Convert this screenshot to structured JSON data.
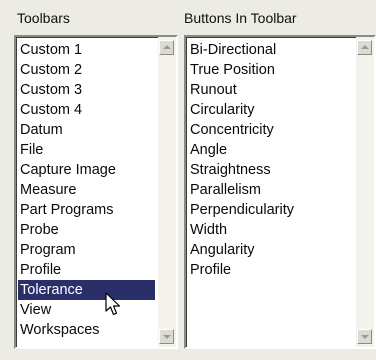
{
  "toolbars": {
    "label": "Toolbars",
    "items": [
      "Custom 1",
      "Custom 2",
      "Custom 3",
      "Custom 4",
      "Datum",
      "File",
      "Capture Image",
      "Measure",
      "Part Programs",
      "Probe",
      "Program",
      "Profile",
      "Tolerance",
      "View",
      "Workspaces"
    ],
    "selected": "Tolerance"
  },
  "buttons_in_toolbar": {
    "label": "Buttons In Toolbar",
    "items": [
      "Bi-Directional",
      "True Position",
      "Runout",
      "Circularity",
      "Concentricity",
      "Angle",
      "Straightness",
      "Parallelism",
      "Perpendicularity",
      "Width",
      "Angularity",
      "Profile"
    ]
  },
  "icons": {
    "scroll_up": "scroll-up-arrow-icon",
    "scroll_down": "scroll-down-arrow-icon",
    "pointer": "mouse-pointer-icon"
  },
  "colors": {
    "selection_background": "#2a2f6a",
    "selection_text": "#ffffff"
  }
}
